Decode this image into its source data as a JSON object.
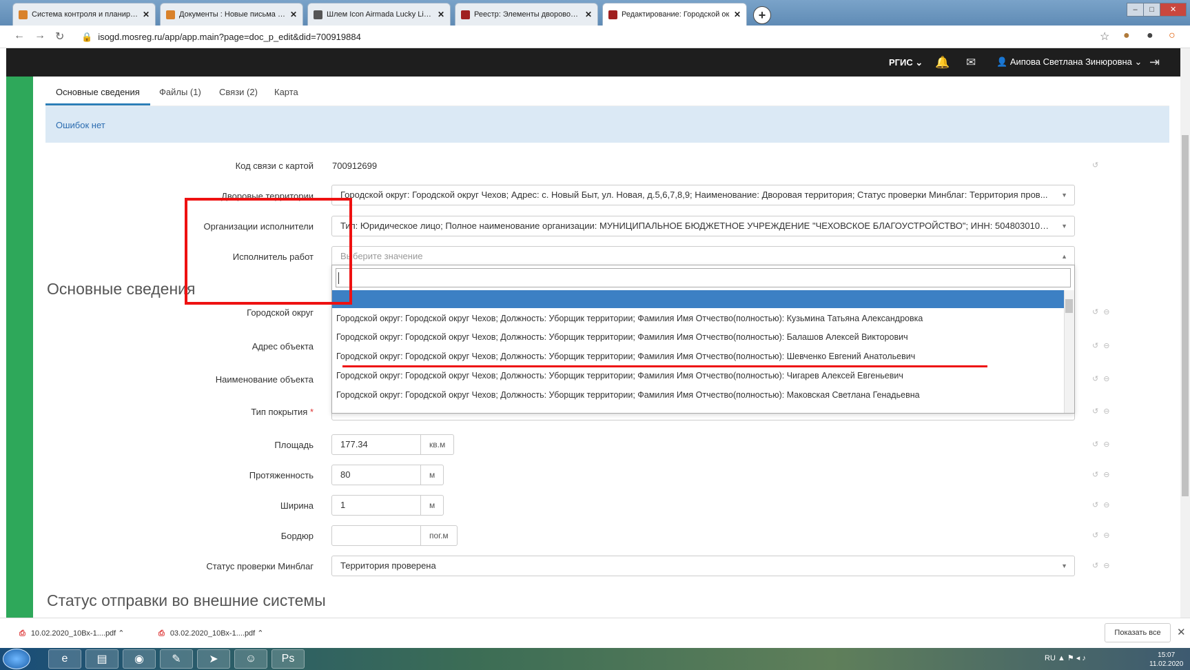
{
  "browser": {
    "tabs": [
      {
        "title": "Система контроля и планирова",
        "favicon_color": "#d9822b"
      },
      {
        "title": "Документы : Новые письма | Эл",
        "favicon_color": "#d9822b"
      },
      {
        "title": "Шлем Icon Airmada Lucky Lid 2 -",
        "favicon_color": "#555555"
      },
      {
        "title": "Реестр: Элементы дворовой тер",
        "favicon_color": "#a02020"
      },
      {
        "title": "Редактирование: Городской ок",
        "favicon_color": "#a02020"
      }
    ],
    "new_tab_label": "+",
    "url": "isogd.mosreg.ru/app/app.main?page=doc_p_edit&did=700919884"
  },
  "header": {
    "rgis_label": "РГИС",
    "user_name": "Аипова Светлана Зинюровна"
  },
  "tabs": {
    "main": "Основные сведения",
    "files": "Файлы (1)",
    "links": "Связи (2)",
    "map": "Карта"
  },
  "errors_text": "Ошибок нет",
  "form": {
    "link_code_label": "Код связи с картой",
    "link_code_value": "700912699",
    "yard_label": "Дворовые территории",
    "yard_value": "Городской округ: Городской округ Чехов; Адрес: с. Новый Быт, ул. Новая, д.5,6,7,8,9; Наименование: Дворовая территория; Статус проверки Минблаг: Территория пров...",
    "org_label": "Организации исполнители",
    "org_value": "Тип: Юридическое лицо; Полное наименование организации: МУНИЦИПАЛЬНОЕ БЮДЖЕТНОЕ УЧРЕЖДЕНИЕ \"ЧЕХОВСКОЕ БЛАГОУСТРОЙСТВО\"; ИНН: 5048030108; ОГР...",
    "executor_label": "Исполнитель работ",
    "executor_placeholder": "Выберите значение",
    "section_main": "Основные сведения",
    "city_label": "Городской округ",
    "address_label": "Адрес объекта",
    "name_label": "Наименование объекта",
    "cover_label": "Тип покрытия",
    "required_mark": "*",
    "area_label": "Площадь",
    "area_value": "177.34",
    "area_unit": "кв.м",
    "length_label": "Протяженность",
    "length_value": "80",
    "length_unit": "м",
    "width_label": "Ширина",
    "width_value": "1",
    "width_unit": "м",
    "curb_label": "Бордюр",
    "curb_value": "",
    "curb_unit": "пог.м",
    "status_label": "Статус проверки Минблаг",
    "status_value": "Территория проверена",
    "section_ext": "Статус отправки во внешние системы"
  },
  "dropdown": {
    "options": [
      "Городской округ: Городской округ Чехов; Должность: Уборщик территории; Фамилия Имя Отчество(полностью): Кузьмина Татьяна Александровка",
      "Городской округ: Городской округ Чехов; Должность: Уборщик территории; Фамилия Имя Отчество(полностью): Балашов Алексей Викторович",
      "Городской округ: Городской округ Чехов; Должность: Уборщик территории; Фамилия Имя Отчество(полностью): Шевченко Евгений Анатольевич",
      "Городской округ: Городской округ Чехов; Должность: Уборщик территории; Фамилия Имя Отчество(полностью): Чигарев Алексей Евгеньевич",
      "Городской округ: Городской округ Чехов; Должность: Уборщик территории; Фамилия Имя Отчество(полностью): Маковская Светлана Генадьевна"
    ]
  },
  "downloads": {
    "items": [
      "10.02.2020_10Вх-1....pdf",
      "03.02.2020_10Вх-1....pdf"
    ],
    "show_all": "Показать все"
  },
  "taskbar": {
    "lang": "RU",
    "time": "15:07",
    "date": "11.02.2020"
  }
}
